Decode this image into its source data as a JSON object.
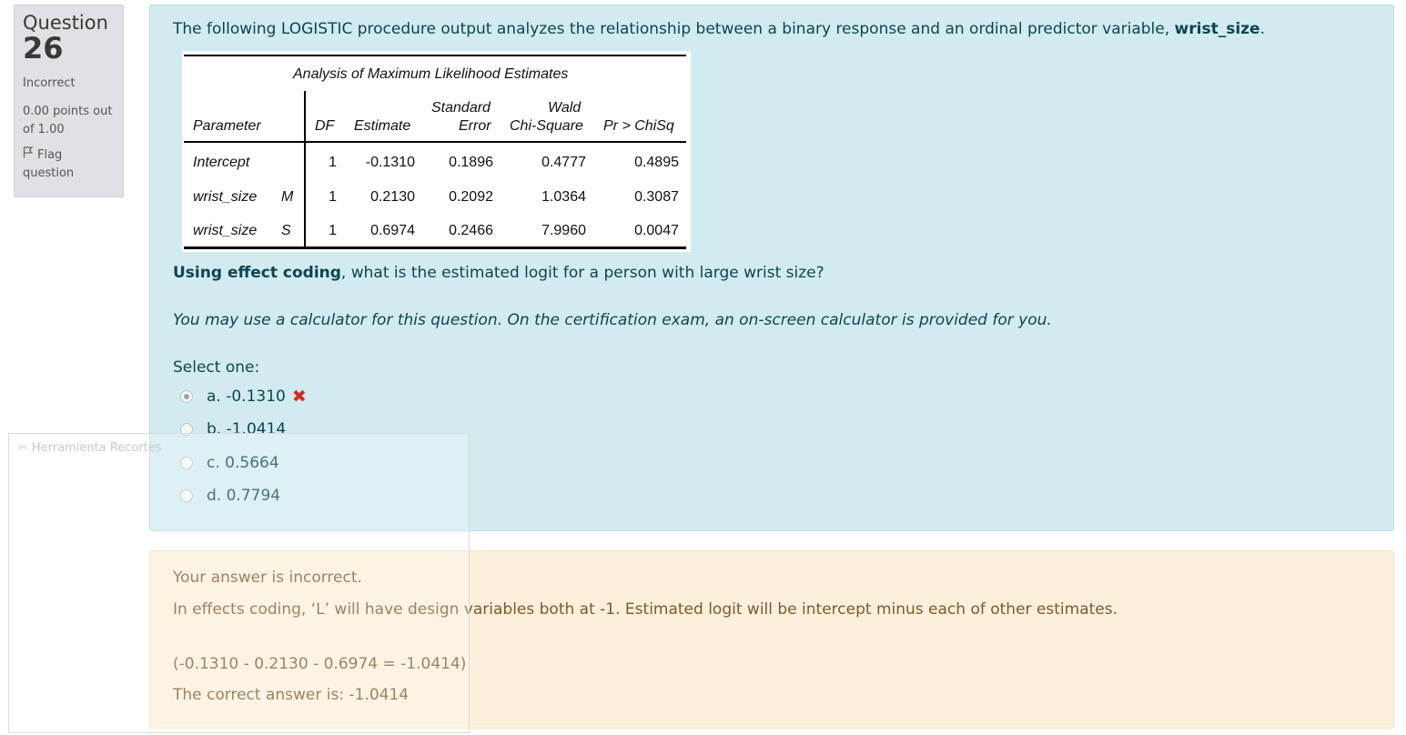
{
  "info": {
    "question_label": "Question",
    "question_number": "26",
    "state": "Incorrect",
    "grade": "0.00 points out of 1.00",
    "flag": "Flag question"
  },
  "question": {
    "intro": "The following LOGISTIC procedure output analyzes the relationship between a binary response and an ordinal predictor variable,",
    "intro_var": "wrist_size",
    "intro_end": ".",
    "prompt_bold": "Using effect coding",
    "prompt_rest": ", what is the estimated logit for a person with large wrist size?",
    "note": "You may use a calculator for this question. On the certification exam, an on-screen calculator is provided for you.",
    "select_label": "Select one:"
  },
  "sas_table": {
    "title": "Analysis of Maximum Likelihood Estimates",
    "headers": {
      "parameter": "Parameter",
      "df": "DF",
      "estimate": "Estimate",
      "se_top": "Standard",
      "se_bottom": "Error",
      "wald_top": "Wald",
      "wald_bottom": "Chi-Square",
      "p": "Pr > ChiSq"
    },
    "rows": [
      {
        "param": "Intercept",
        "level": "",
        "df": "1",
        "estimate": "-0.1310",
        "se": "0.1896",
        "wald": "0.4777",
        "p": "0.4895"
      },
      {
        "param": "wrist_size",
        "level": "M",
        "df": "1",
        "estimate": "0.2130",
        "se": "0.2092",
        "wald": "1.0364",
        "p": "0.3087"
      },
      {
        "param": "wrist_size",
        "level": "S",
        "df": "1",
        "estimate": "0.6974",
        "se": "0.2466",
        "wald": "7.9960",
        "p": "0.0047"
      }
    ]
  },
  "options": [
    {
      "label": "a. -0.1310",
      "checked": true,
      "marked_incorrect": true
    },
    {
      "label": "b. -1.0414",
      "checked": false,
      "marked_incorrect": false
    },
    {
      "label": "c. 0.5664",
      "checked": false,
      "marked_incorrect": false
    },
    {
      "label": "d. 0.7794",
      "checked": false,
      "marked_incorrect": false
    }
  ],
  "feedback": {
    "status": "Your answer is incorrect.",
    "explanation": "In effects coding, ‘L’ will have design variables both at -1. Estimated logit will be intercept minus each of other estimates.",
    "calculation": "(-0.1310 - 0.2130 - 0.6974 = -1.0414)",
    "correct_answer": "The correct answer is: -1.0414"
  },
  "overlay": {
    "title": "Herramienta Recortes"
  },
  "colors": {
    "content_bg": "#d2ebf0",
    "feedback_bg": "#fcefdc",
    "info_bg": "#dee2e6",
    "incorrect_mark": "#ca3120"
  }
}
